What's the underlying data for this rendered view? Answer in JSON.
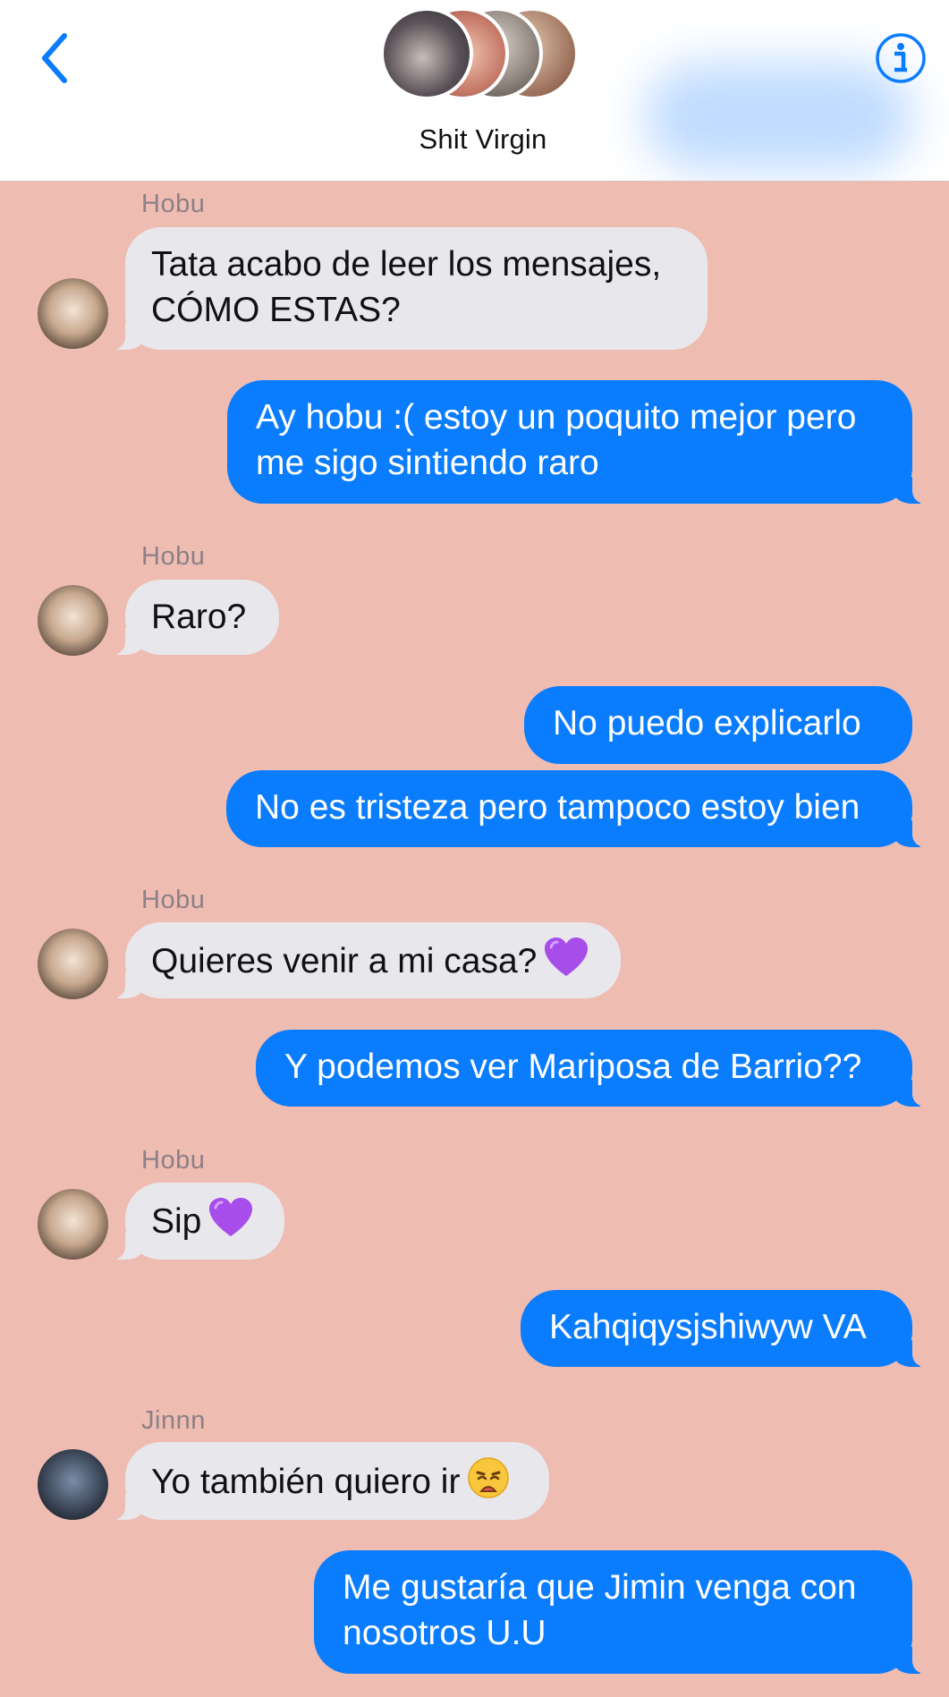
{
  "header": {
    "group_name": "Shit Virgin",
    "back_icon": "chevron-left-icon",
    "info_icon": "info-icon",
    "accent": "#0a7cfe"
  },
  "colors": {
    "background": "#efbcb2",
    "incoming_bubble": "#e8e7ec",
    "outgoing_bubble": "#0a7cfe"
  },
  "messages": [
    {
      "sender": "Hobu",
      "direction": "in",
      "line1": "Tata acabo de leer los mensajes,",
      "line2": "CÓMO ESTAS?"
    },
    {
      "direction": "out",
      "line1": "Ay hobu :( estoy un poquito mejor pero",
      "line2": "me sigo sintiendo raro"
    },
    {
      "sender": "Hobu",
      "direction": "in",
      "text": "Raro?"
    },
    {
      "direction": "out",
      "text": "No puedo explicarlo"
    },
    {
      "direction": "out",
      "text": "No es tristeza pero tampoco estoy bien"
    },
    {
      "sender": "Hobu",
      "direction": "in",
      "text": "Quieres venir a mi casa?",
      "emoji": "purple-heart"
    },
    {
      "direction": "out",
      "text": "Y podemos ver Mariposa de Barrio??"
    },
    {
      "sender": "Hobu",
      "direction": "in",
      "text": "Sip",
      "emoji": "purple-heart"
    },
    {
      "direction": "out",
      "text": "Kahqiqysjshiwyw VA"
    },
    {
      "sender": "Jinnn",
      "direction": "in",
      "text": "Yo también quiero ir",
      "emoji": "weary-face"
    },
    {
      "direction": "out",
      "line1": "Me gustaría que Jimin venga con",
      "line2": "nosotros U.U"
    }
  ]
}
